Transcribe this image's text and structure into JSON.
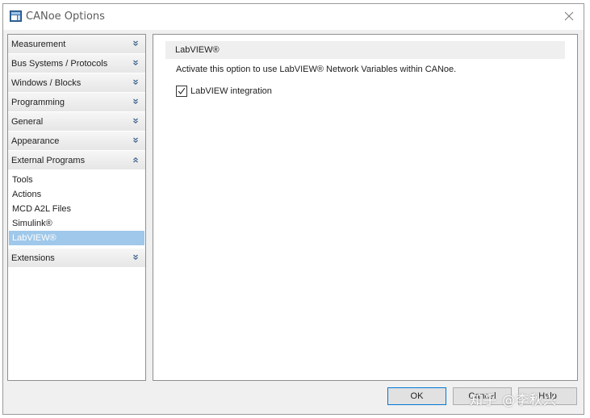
{
  "window": {
    "title": "CANoe Options",
    "icon": "canoe-app-icon",
    "close_icon": "close-icon"
  },
  "sidebar": {
    "groups": [
      {
        "label": "Measurement",
        "expanded": false
      },
      {
        "label": "Bus Systems / Protocols",
        "expanded": false
      },
      {
        "label": "Windows / Blocks",
        "expanded": false
      },
      {
        "label": "Programming",
        "expanded": false
      },
      {
        "label": "General",
        "expanded": false
      },
      {
        "label": "Appearance",
        "expanded": false
      },
      {
        "label": "External Programs",
        "expanded": true,
        "items": [
          {
            "label": "Tools",
            "selected": false
          },
          {
            "label": "Actions",
            "selected": false
          },
          {
            "label": "MCD A2L Files",
            "selected": false
          },
          {
            "label": "Simulink®",
            "selected": false
          },
          {
            "label": "LabVIEW®",
            "selected": true
          }
        ]
      },
      {
        "label": "Extensions",
        "expanded": false
      }
    ],
    "selected_color": "#9fc8ea"
  },
  "content": {
    "section_title": "LabVIEW®",
    "description": "Activate this option to use LabVIEW® Network Variables within CANoe.",
    "checkbox": {
      "label": "LabVIEW integration",
      "checked": true
    }
  },
  "buttons": {
    "ok": "OK",
    "cancel": "Cancel",
    "help": "Help"
  },
  "watermark": "知乎 @李秋兴",
  "colors": {
    "accent": "#0078d7"
  }
}
